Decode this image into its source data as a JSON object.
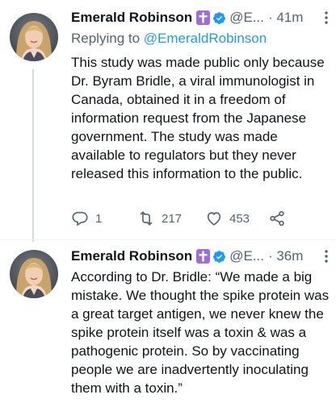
{
  "thread": [
    {
      "author": {
        "name": "Emerald Robinson",
        "handle": "@E...",
        "avatar": "woman-portrait-avatar"
      },
      "time": "· 41m",
      "replying_label": "Replying to",
      "replying_handle": "@EmeraldRobinson",
      "text": "This study was made public only because Dr. Byram Bridle, a viral immunologist in Canada, obtained it in a freedom of information request from the Japanese government. The study was made available to regulators but they never released this information to the public.",
      "actions": {
        "reply_count": "1",
        "retweet_count": "217",
        "like_count": "453"
      }
    },
    {
      "author": {
        "name": "Emerald Robinson",
        "handle": "@E...",
        "avatar": "woman-portrait-avatar"
      },
      "time": "· 36m",
      "text": "According to Dr. Bridle: “We made a big mistake. We thought the spike protein was a great target antigen, we never knew the spike protein itself was a toxin & was a pathogenic protein. So by vaccinating people we are inadvertently inoculating them with a toxin.”"
    }
  ],
  "icons": {
    "badge": "cross-badge-icon",
    "verified": "verified-badge-icon",
    "more": "more-vertical-icon",
    "reply": "reply-icon",
    "retweet": "retweet-icon",
    "like": "heart-icon",
    "share": "share-icon"
  },
  "colors": {
    "accent": "#1d9bf0",
    "badge_purple": "#9d6fd6",
    "text_primary": "#0f1419",
    "text_secondary": "#536471"
  }
}
